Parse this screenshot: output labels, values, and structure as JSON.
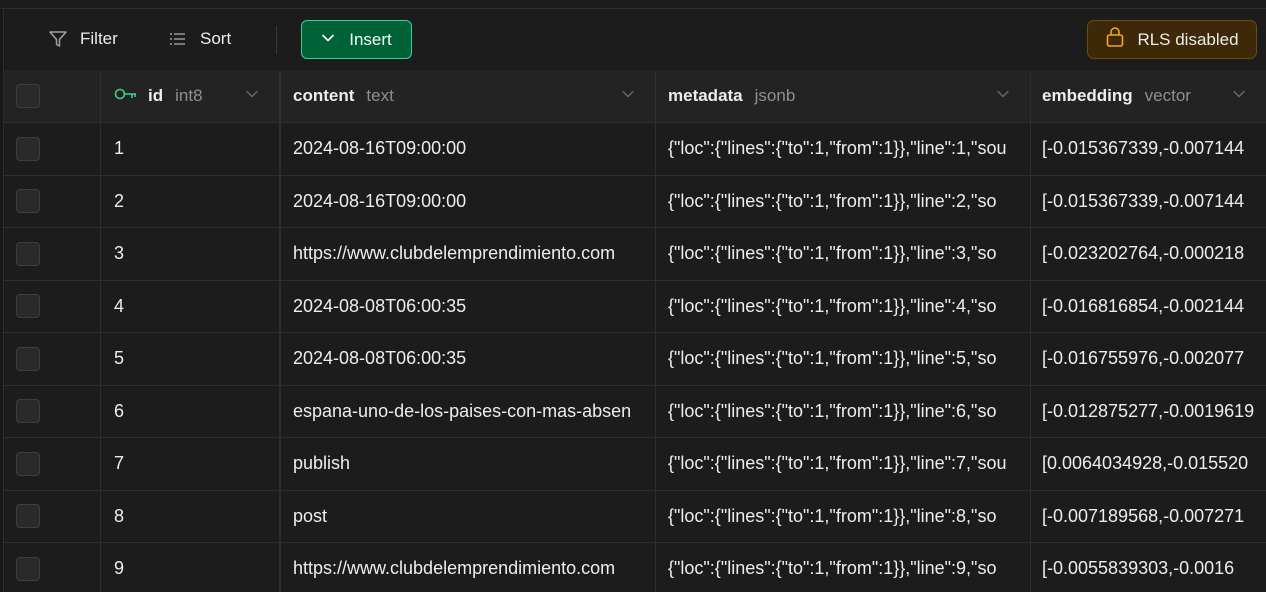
{
  "toolbar": {
    "filter_label": "Filter",
    "sort_label": "Sort",
    "insert_label": "Insert",
    "rls_label": "RLS disabled"
  },
  "columns": [
    {
      "name": "id",
      "type": "int8"
    },
    {
      "name": "content",
      "type": "text"
    },
    {
      "name": "metadata",
      "type": "jsonb"
    },
    {
      "name": "embedding",
      "type": "vector"
    }
  ],
  "rows": [
    {
      "id": "1",
      "content": "2024-08-16T09:00:00",
      "metadata": "{\"loc\":{\"lines\":{\"to\":1,\"from\":1}},\"line\":1,\"sou",
      "embedding": "[-0.015367339,-0.007144"
    },
    {
      "id": "2",
      "content": "2024-08-16T09:00:00",
      "metadata": "{\"loc\":{\"lines\":{\"to\":1,\"from\":1}},\"line\":2,\"so",
      "embedding": "[-0.015367339,-0.007144"
    },
    {
      "id": "3",
      "content": "https://www.clubdelemprendimiento.com",
      "metadata": "{\"loc\":{\"lines\":{\"to\":1,\"from\":1}},\"line\":3,\"so",
      "embedding": "[-0.023202764,-0.000218"
    },
    {
      "id": "4",
      "content": "2024-08-08T06:00:35",
      "metadata": "{\"loc\":{\"lines\":{\"to\":1,\"from\":1}},\"line\":4,\"so",
      "embedding": "[-0.016816854,-0.002144"
    },
    {
      "id": "5",
      "content": "2024-08-08T06:00:35",
      "metadata": "{\"loc\":{\"lines\":{\"to\":1,\"from\":1}},\"line\":5,\"so",
      "embedding": "[-0.016755976,-0.002077"
    },
    {
      "id": "6",
      "content": "espana-uno-de-los-paises-con-mas-absen",
      "metadata": "{\"loc\":{\"lines\":{\"to\":1,\"from\":1}},\"line\":6,\"so",
      "embedding": "[-0.012875277,-0.0019619"
    },
    {
      "id": "7",
      "content": "publish",
      "metadata": "{\"loc\":{\"lines\":{\"to\":1,\"from\":1}},\"line\":7,\"sou",
      "embedding": "[0.0064034928,-0.015520"
    },
    {
      "id": "8",
      "content": "post",
      "metadata": "{\"loc\":{\"lines\":{\"to\":1,\"from\":1}},\"line\":8,\"so",
      "embedding": "[-0.007189568,-0.007271"
    },
    {
      "id": "9",
      "content": "https://www.clubdelemprendimiento.com",
      "metadata": "{\"loc\":{\"lines\":{\"to\":1,\"from\":1}},\"line\":9,\"so",
      "embedding": "[-0.0055839303,-0.0016"
    }
  ],
  "icons": {
    "filter": "filter-icon",
    "sort": "sort-icon",
    "insert": "chevron-down-icon",
    "rls": "lock-icon",
    "primary_key": "key-icon"
  },
  "colors": {
    "background": "#1c1c1c",
    "insert_bg": "#006239",
    "insert_border": "#3ecf8e",
    "rls_bg": "#3d2807",
    "rls_icon": "#f5a623",
    "key_icon": "#3ecf8e"
  }
}
